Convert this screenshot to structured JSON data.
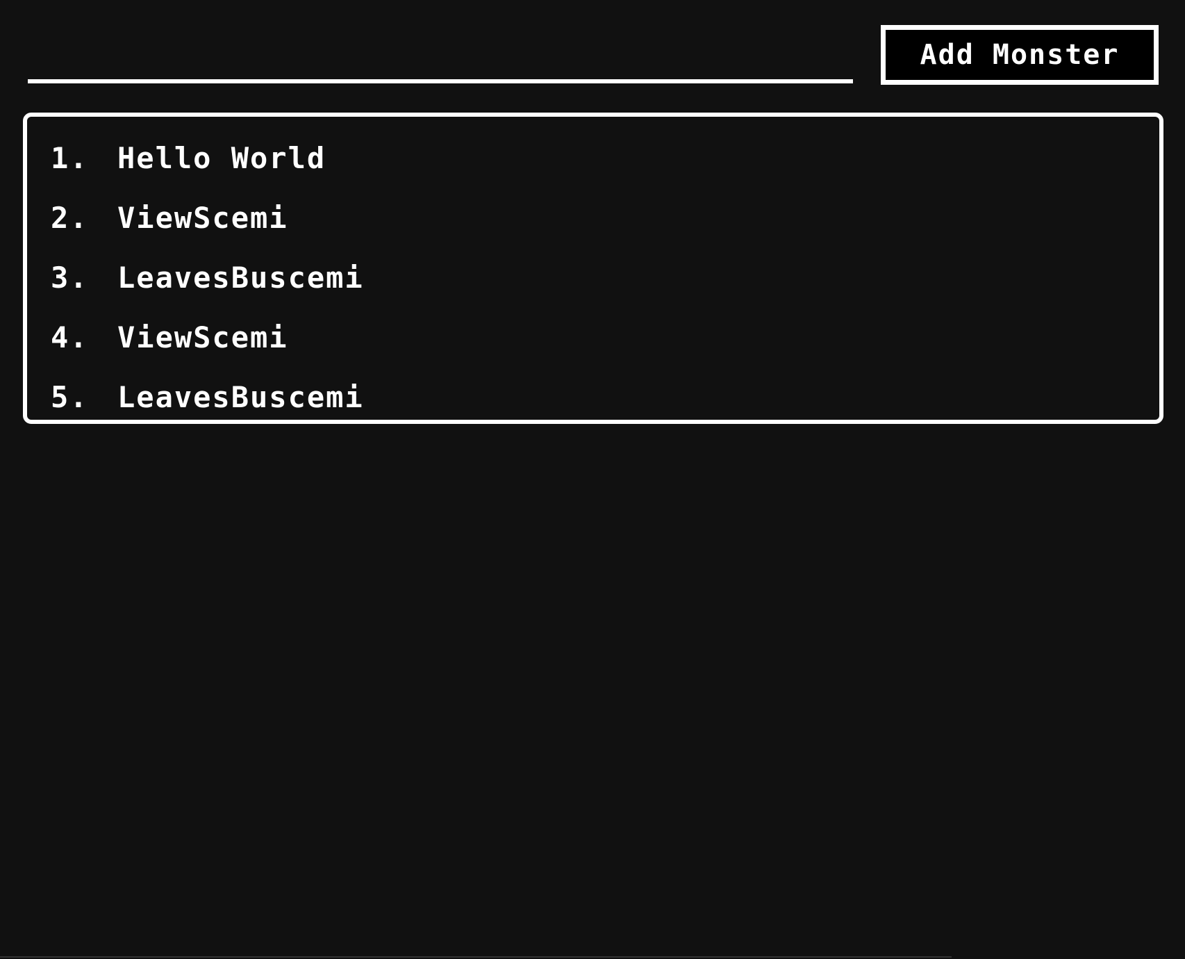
{
  "header": {
    "input_value": "",
    "input_placeholder": "",
    "add_button_label": "Add Monster"
  },
  "monsters": [
    {
      "number": "1.",
      "name": "Hello World"
    },
    {
      "number": "2.",
      "name": "ViewScemi"
    },
    {
      "number": "3.",
      "name": "LeavesBuscemi"
    },
    {
      "number": "4.",
      "name": "ViewScemi"
    },
    {
      "number": "5.",
      "name": "LeavesBuscemi"
    }
  ],
  "colors": {
    "background": "#111111",
    "foreground": "#ffffff",
    "button_background": "#000000"
  }
}
